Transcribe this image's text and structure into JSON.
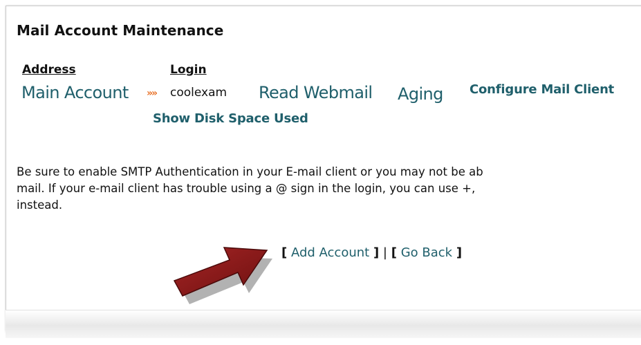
{
  "page": {
    "title": "Mail Account Maintenance"
  },
  "columns": {
    "address": "Address",
    "login": "Login"
  },
  "account": {
    "address_link": "Main Account",
    "arrow_glyph": "»»",
    "login_value": "coolexam",
    "read_webmail": "Read Webmail",
    "aging": "Aging",
    "configure_mail_client": "Configure Mail Client",
    "show_disk_space": "Show Disk Space Used"
  },
  "notice": {
    "line1": "Be sure to enable SMTP Authentication in your E-mail client or you may not be ab",
    "line2": "mail. If your e-mail client has trouble using a @ sign in the login, you can use +,",
    "line3": "instead."
  },
  "actions": {
    "open_bracket": "[",
    "close_bracket": "]",
    "separator": "|",
    "add_account": "Add Account",
    "go_back": "Go Back"
  },
  "colors": {
    "link": "#1f5f6b",
    "arrow_glyph": "#e8732a",
    "annotation_arrow": "#8b1a1a"
  },
  "icons": {
    "annotation_arrow": "red-arrow-pointer-icon"
  }
}
